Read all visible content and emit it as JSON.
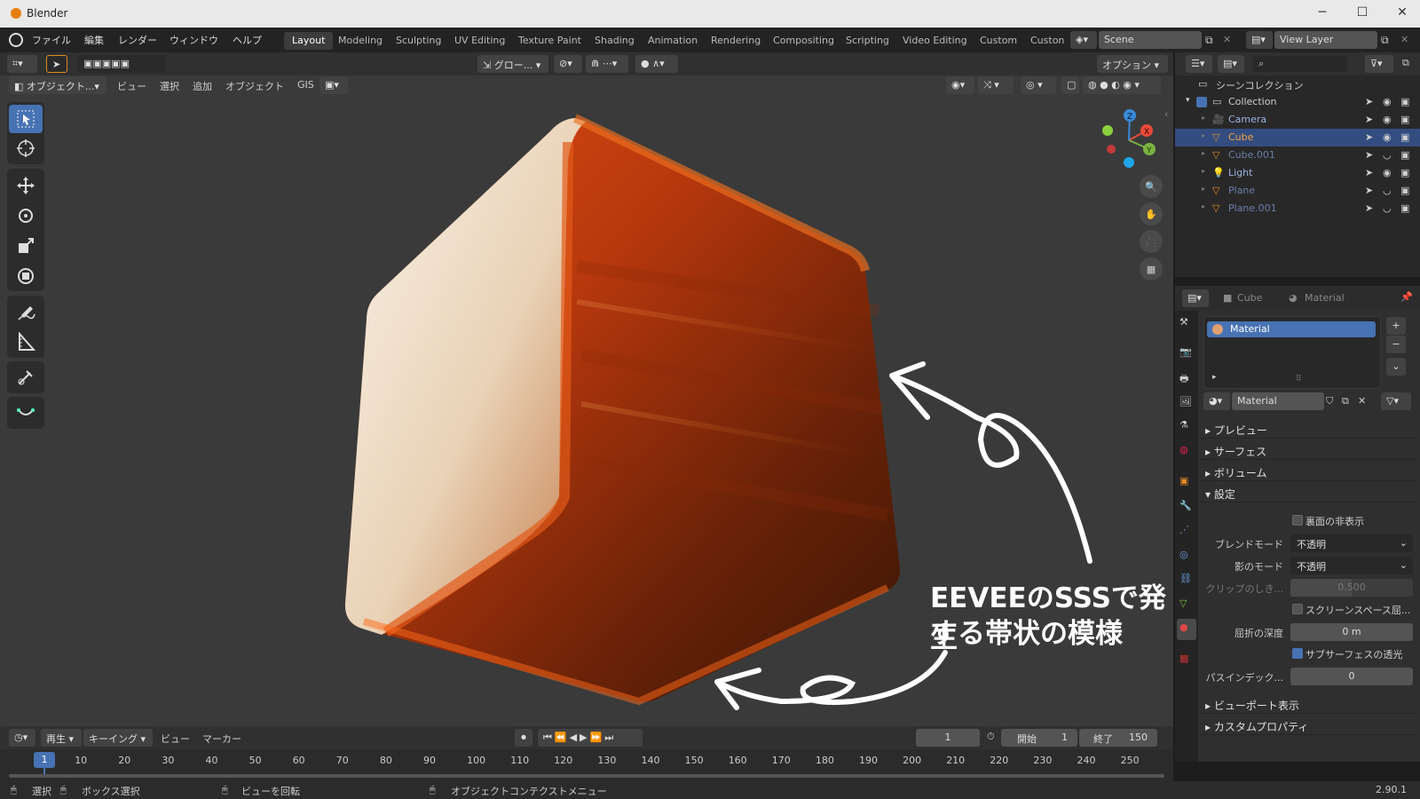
{
  "window": {
    "title": "Blender",
    "minimize": "─",
    "maximize": "☐",
    "close": "✕"
  },
  "menu": [
    "ファイル",
    "編集",
    "レンダー",
    "ウィンドウ",
    "ヘルプ"
  ],
  "workspaces": [
    "Layout",
    "Modeling",
    "Sculpting",
    "UV Editing",
    "Texture Paint",
    "Shading",
    "Animation",
    "Rendering",
    "Compositing",
    "Scripting",
    "Video Editing",
    "Custom",
    "Custon"
  ],
  "active_workspace": "Layout",
  "scene": {
    "name": "Scene"
  },
  "view_layer": {
    "name": "View Layer"
  },
  "tool_header": {
    "transform_orientation": "グロー...",
    "options": "オプション"
  },
  "viewport_header": {
    "mode": "オブジェクト...",
    "view": "ビュー",
    "select": "選択",
    "add": "追加",
    "object": "オブジェクト",
    "gis": "GIS"
  },
  "annotation": {
    "line1": "EEVEEのSSSで発生",
    "line2": "する帯状の模様"
  },
  "outliner": {
    "root": "シーンコレクション",
    "collection": "Collection",
    "items": [
      {
        "name": "Camera",
        "selected": false,
        "hidden": false
      },
      {
        "name": "Cube",
        "selected": true,
        "hidden": false
      },
      {
        "name": "Cube.001",
        "selected": false,
        "hidden": true
      },
      {
        "name": "Light",
        "selected": false,
        "hidden": false
      },
      {
        "name": "Plane",
        "selected": false,
        "hidden": true
      },
      {
        "name": "Plane.001",
        "selected": false,
        "hidden": true
      }
    ]
  },
  "properties": {
    "breadcrumb_object": "Cube",
    "breadcrumb_material": "Material",
    "slot_name": "Material",
    "material_name": "Material",
    "panels": {
      "preview": "プレビュー",
      "surface": "サーフェス",
      "volume": "ボリューム",
      "settings": "設定",
      "viewport_display": "ビューポート表示",
      "custom_props": "カスタムプロパティ"
    },
    "backface_culling": {
      "label": "裏面の非表示",
      "checked": false
    },
    "blend_mode": {
      "label": "ブレンドモード",
      "value": "不透明"
    },
    "shadow_mode": {
      "label": "影のモード",
      "value": "不透明"
    },
    "clip_threshold": {
      "label": "クリップのしき...",
      "value": "0.500"
    },
    "screen_space_refraction": {
      "label": "スクリーンスペース屈...",
      "checked": false
    },
    "refraction_depth": {
      "label": "屈折の深度",
      "value": "0 m"
    },
    "subsurface_translucency": {
      "label": "サブサーフェスの透光",
      "checked": true
    },
    "pass_index": {
      "label": "パスインデック...",
      "value": "0"
    }
  },
  "timeline": {
    "playback": "再生",
    "keying": "キーイング",
    "view": "ビュー",
    "marker": "マーカー",
    "current_frame": "1",
    "start_label": "開始",
    "start": "1",
    "end_label": "終了",
    "end": "150",
    "ticks": [
      "1",
      "10",
      "20",
      "30",
      "40",
      "50",
      "60",
      "70",
      "80",
      "90",
      "100",
      "110",
      "120",
      "130",
      "140",
      "150",
      "160",
      "170",
      "180",
      "190",
      "200",
      "210",
      "220",
      "230",
      "240",
      "250"
    ]
  },
  "status": {
    "select": "選択",
    "box_select": "ボックス選択",
    "rotate_view": "ビューを回転",
    "context_menu": "オブジェクトコンテクストメニュー",
    "version": "2.90.1"
  },
  "colors": {
    "accent": "#4772b3",
    "cube_orange": "#c4420f",
    "cube_light": "#f2e6d7",
    "viewport_bg": "#3a3a3a"
  }
}
